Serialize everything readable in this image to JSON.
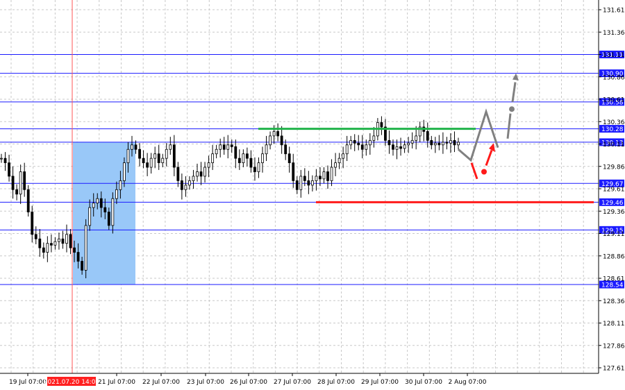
{
  "chart_data": {
    "type": "candlestick",
    "grid": true,
    "y_axis_ticks": [
      "131.61",
      "131.36",
      "131.11",
      "130.86",
      "130.61",
      "130.36",
      "130.11",
      "129.86",
      "129.61",
      "129.36",
      "129.11",
      "128.86",
      "128.61",
      "128.36",
      "128.11",
      "127.86",
      "127.61"
    ],
    "x_axis_ticks": [
      "19 Jul 07:00",
      "21 Jul 07:00",
      "22 Jul 07:00",
      "23 Jul 07:00",
      "26 Jul 07:00",
      "27 Jul 07:00",
      "28 Jul 07:00",
      "29 Jul 07:00",
      "30 Jul 07:00",
      "2 Aug 07:00"
    ],
    "cursor_time_label": "2021.07.20 14:00",
    "levels": [
      {
        "price": 131.11,
        "label": "131.11"
      },
      {
        "price": 130.9,
        "label": "130.90"
      },
      {
        "price": 130.58,
        "label": "130.58"
      },
      {
        "price": 130.28,
        "label": "130.28"
      },
      {
        "price": 130.13,
        "label": "130.13"
      },
      {
        "price": 129.67,
        "label": "129.67"
      },
      {
        "price": 129.46,
        "label": "129.46"
      },
      {
        "price": 129.15,
        "label": "129.15"
      },
      {
        "price": 128.54,
        "label": "128.54"
      }
    ],
    "highlight_zone": {
      "from": "2021.07.20 14:00",
      "to": "21 Jul",
      "low": 128.54,
      "high": 130.13,
      "color": "#99c8f8"
    },
    "resistance_line": {
      "price": 130.28,
      "color": "#21b24a"
    },
    "support_line": {
      "price": 129.46,
      "color": "#ff1a1a"
    },
    "close_path": [
      129.95,
      129.9,
      129.75,
      129.6,
      129.55,
      129.8,
      129.6,
      129.35,
      129.1,
      129.05,
      128.95,
      128.9,
      129.0,
      128.98,
      129.02,
      129.05,
      129.0,
      129.1,
      128.95,
      128.9,
      128.8,
      128.7,
      129.2,
      129.4,
      129.45,
      129.5,
      129.4,
      129.35,
      129.2,
      129.5,
      129.6,
      129.7,
      129.9,
      130.05,
      130.1,
      130.05,
      129.95,
      129.9,
      129.85,
      129.95,
      130.0,
      129.9,
      129.95,
      130.05,
      130.1,
      129.85,
      129.7,
      129.6,
      129.65,
      129.7,
      129.75,
      129.8,
      129.75,
      129.85,
      129.9,
      130.0,
      130.05,
      130.1,
      130.05,
      130.1,
      130.08,
      129.95,
      129.9,
      130.0,
      129.95,
      129.85,
      129.8,
      129.9,
      130.0,
      130.1,
      130.2,
      130.25,
      130.2,
      130.1,
      130.0,
      129.9,
      129.7,
      129.6,
      129.75,
      129.7,
      129.65,
      129.7,
      129.75,
      129.72,
      129.8,
      129.7,
      129.85,
      129.9,
      129.95,
      130.0,
      130.1,
      130.15,
      130.12,
      130.1,
      130.05,
      130.1,
      130.15,
      130.2,
      130.35,
      130.3,
      130.15,
      130.1,
      130.05,
      130.08,
      130.06,
      130.1,
      130.12,
      130.15,
      130.2,
      130.3,
      130.25,
      130.15,
      130.1,
      130.12,
      130.1,
      130.13,
      130.12,
      130.15,
      130.1,
      130.13
    ],
    "projection_gray": [
      130.05,
      130.35,
      130.22,
      130.5,
      130.85
    ],
    "projection_red": [
      129.85,
      129.75,
      129.8,
      130.1
    ]
  }
}
